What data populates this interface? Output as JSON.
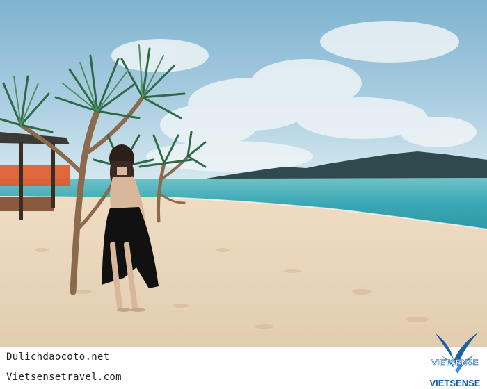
{
  "photo": {
    "subject": "beach-scene",
    "colors": {
      "sky": "#9fc6dc",
      "sea": "#3aa8b4",
      "sand": "#e6d1b6",
      "hills": "#2f4a4e"
    }
  },
  "footer": {
    "caption_1": "Dulichdaocoto.net",
    "caption_2": "Vietsensetravel.com"
  },
  "logo": {
    "icon": "bird-logo-icon",
    "wordmark": "VIETSENSE",
    "color": "#1e5fa8"
  }
}
